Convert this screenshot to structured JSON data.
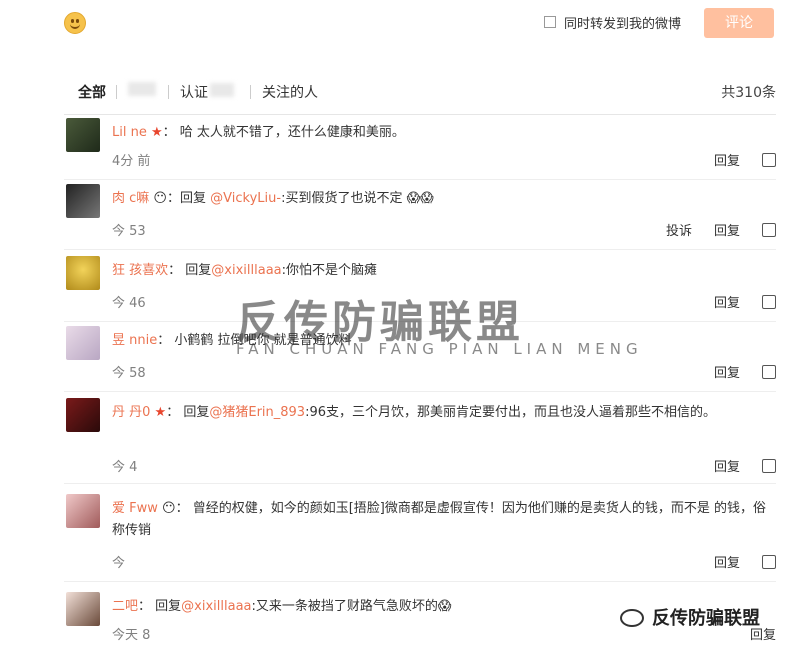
{
  "composer": {
    "repost_label": "同时转发到我的微博",
    "submit_label": "评论"
  },
  "filters": {
    "tabs": [
      "全部",
      "认证",
      "关注的人"
    ],
    "count": "共310条"
  },
  "comments": [
    {
      "name": "Lil   ne",
      "text": "哈   太人就不错了，还什么健康和美丽。",
      "time": "4分   前",
      "actions": [
        "回复"
      ]
    },
    {
      "name": "肉   c嘛",
      "reply_to": "@VickyLiu-",
      "text": ":买到假货了也说不定",
      "time": "今   53",
      "actions": [
        "投诉",
        "回复"
      ]
    },
    {
      "name": "狂   孩喜欢",
      "reply_prefix": "回复",
      "reply_to": "@xixilllaaa",
      "text": ":你怕不是个脑瘫",
      "time": "今   46",
      "actions": [
        "回复"
      ]
    },
    {
      "name": "昱   nnie",
      "text": "小鹤鹤   拉倒吧你 就是普通饮料",
      "time": "今   58",
      "actions": [
        "回复"
      ]
    },
    {
      "name": "丹   丹0",
      "reply_prefix": "回复",
      "reply_to": "@猪猪Erin_893",
      "text": ":96支，三个月饮，那美丽肯定要付出，而且也没人逼着那些不相信的。",
      "time": "今   4",
      "actions": [
        "回复"
      ]
    },
    {
      "name": "爱   Fww",
      "text": "曾经的权健，如今的颜如玉[捂脸]微商都是虚假宣传！因为他们赚的是卖货人的钱，而不是   的钱，俗称传销",
      "time": "今",
      "actions": [
        "回复"
      ]
    },
    {
      "name": "二吧",
      "reply_prefix": "回复",
      "reply_to": "@xixilllaaa",
      "text": ":又来一条被挡了财路气急败坏的",
      "time": "今天   8",
      "actions": [
        "回复"
      ]
    }
  ],
  "watermark": {
    "title": "反传防骗联盟",
    "subtitle": "FAN CHUAN FANG PIAN LIAN MENG"
  },
  "footer": {
    "account": "反传防骗联盟"
  }
}
